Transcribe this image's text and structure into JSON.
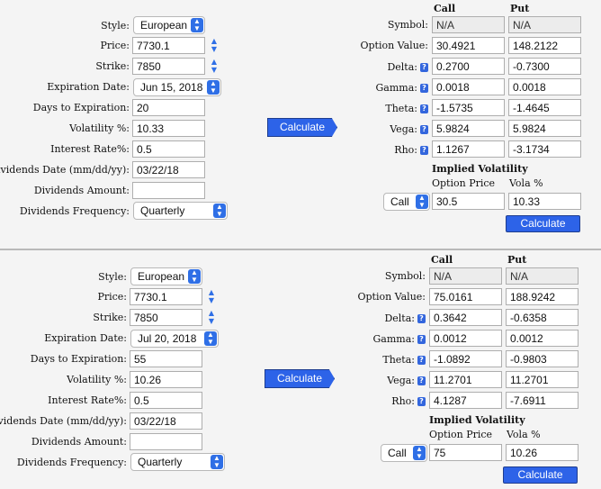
{
  "labels": {
    "style": "Style:",
    "price": "Price:",
    "strike": "Strike:",
    "expiration_date": "Expiration Date:",
    "days_to_expiration": "Days to Expiration:",
    "volatility": "Volatility %:",
    "interest_rate": "Interest Rate%:",
    "dividends_date": "Dividends Date (mm/dd/yy):",
    "dividends_amount": "Dividends Amount:",
    "dividends_frequency": "Dividends Frequency:",
    "call": "Call",
    "put": "Put",
    "symbol": "Symbol:",
    "option_value": "Option Value:",
    "delta": "Delta:",
    "gamma": "Gamma:",
    "theta": "Theta:",
    "vega": "Vega:",
    "rho": "Rho:",
    "implied_volatility": "Implied Volatility",
    "option_price": "Option Price",
    "vola_pct": "Vola %",
    "calculate": "Calculate",
    "help_glyph": "?"
  },
  "panels": [
    {
      "style": "European",
      "price": "7730.1",
      "strike": "7850",
      "expiration_date": "Jun 15, 2018",
      "days_to_expiration": "20",
      "volatility": "10.33",
      "interest_rate": "0.5",
      "dividends_date": "03/22/18",
      "dividends_amount": "",
      "dividends_frequency": "Quarterly",
      "call": {
        "symbol": "N/A",
        "option_value": "30.4921",
        "delta": "0.2700",
        "gamma": "0.0018",
        "theta": "-1.5735",
        "vega": "5.9824",
        "rho": "1.1267"
      },
      "put": {
        "symbol": "N/A",
        "option_value": "148.2122",
        "delta": "-0.7300",
        "gamma": "0.0018",
        "theta": "-1.4645",
        "vega": "5.9824",
        "rho": "-3.1734"
      },
      "iv_type": "Call",
      "iv_option_price": "30.5",
      "iv_vola": "10.33"
    },
    {
      "style": "European",
      "price": "7730.1",
      "strike": "7850",
      "expiration_date": "Jul 20, 2018",
      "days_to_expiration": "55",
      "volatility": "10.26",
      "interest_rate": "0.5",
      "dividends_date": "03/22/18",
      "dividends_amount": "",
      "dividends_frequency": "Quarterly",
      "call": {
        "symbol": "N/A",
        "option_value": "75.0161",
        "delta": "0.3642",
        "gamma": "0.0012",
        "theta": "-1.0892",
        "vega": "11.2701",
        "rho": "4.1287"
      },
      "put": {
        "symbol": "N/A",
        "option_value": "188.9242",
        "delta": "-0.6358",
        "gamma": "0.0012",
        "theta": "-0.9803",
        "vega": "11.2701",
        "rho": "-7.6911"
      },
      "iv_type": "Call",
      "iv_option_price": "75",
      "iv_vola": "10.26"
    }
  ]
}
